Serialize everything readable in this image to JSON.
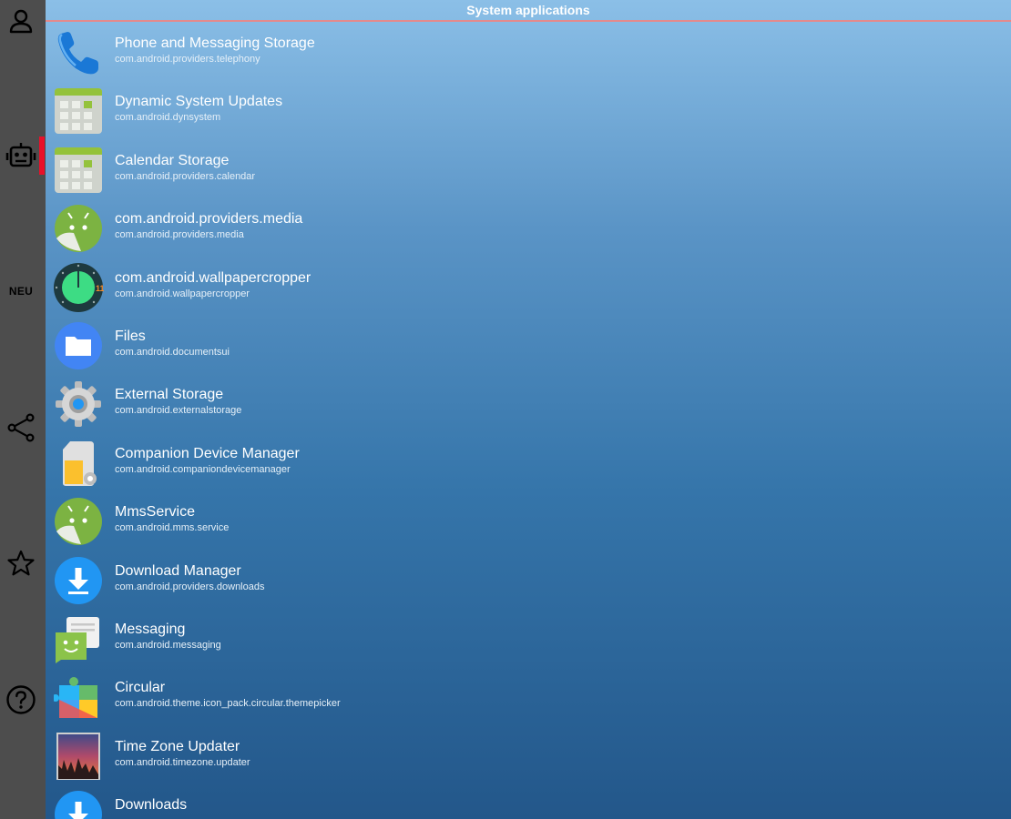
{
  "header": {
    "title": "System applications"
  },
  "sidebar": {
    "items": [
      {
        "icon": "user-icon"
      },
      {
        "icon": "robot-icon",
        "active": true
      },
      {
        "icon": "new-icon",
        "label": "NEU"
      },
      {
        "icon": "share-icon"
      },
      {
        "icon": "star-icon"
      },
      {
        "icon": "help-icon"
      }
    ],
    "active_color": "#e8102a"
  },
  "apps": [
    {
      "name": "Phone and Messaging Storage",
      "package": "com.android.providers.telephony",
      "icon": "phone-icon"
    },
    {
      "name": "Dynamic System Updates",
      "package": "com.android.dynsystem",
      "icon": "system-app-icon"
    },
    {
      "name": "Calendar Storage",
      "package": "com.android.providers.calendar",
      "icon": "system-app-icon"
    },
    {
      "name": "com.android.providers.media",
      "package": "com.android.providers.media",
      "icon": "android-icon"
    },
    {
      "name": "com.android.wallpapercropper",
      "package": "com.android.wallpapercropper",
      "icon": "android11-icon"
    },
    {
      "name": "Files",
      "package": "com.android.documentsui",
      "icon": "files-icon"
    },
    {
      "name": "External Storage",
      "package": "com.android.externalstorage",
      "icon": "gear-icon"
    },
    {
      "name": "Companion Device Manager",
      "package": "com.android.companiondevicemanager",
      "icon": "sd-card-icon"
    },
    {
      "name": "MmsService",
      "package": "com.android.mms.service",
      "icon": "android-icon"
    },
    {
      "name": "Download Manager",
      "package": "com.android.providers.downloads",
      "icon": "download-icon"
    },
    {
      "name": "Messaging",
      "package": "com.android.messaging",
      "icon": "messaging-icon"
    },
    {
      "name": "Circular",
      "package": "com.android.theme.icon_pack.circular.themepicker",
      "icon": "puzzle-icon"
    },
    {
      "name": "Time Zone Updater",
      "package": "com.android.timezone.updater",
      "icon": "timezone-icon"
    },
    {
      "name": "Downloads",
      "package": "",
      "icon": "download-icon"
    }
  ]
}
